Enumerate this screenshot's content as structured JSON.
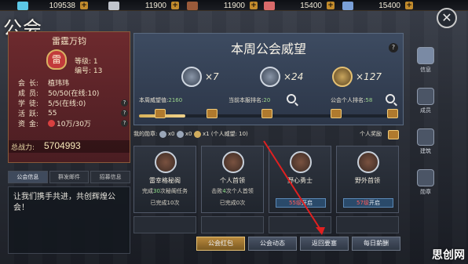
{
  "resources": [
    {
      "value": "109538",
      "color": "#5cc7e6",
      "icon": "diamond-icon"
    },
    {
      "value": "11900",
      "color": "#c0c4cc",
      "icon": "crystal-icon"
    },
    {
      "value": "11900",
      "color": "#9a5a3a",
      "icon": "wood-icon"
    },
    {
      "value": "15400",
      "color": "#d96a6a",
      "icon": "meat-icon"
    },
    {
      "value": "15400",
      "color": "#7aa0d8",
      "icon": "ore-icon"
    }
  ],
  "window": {
    "title": "公会",
    "close": "✕"
  },
  "guild": {
    "name": "雷霆万钧",
    "emblem": "雷",
    "level": "等级: 1",
    "number": "编号: 13",
    "rows": [
      {
        "k": "会",
        "k2": "长:",
        "v": "植玮玮"
      },
      {
        "k": "成",
        "k2": "员:",
        "v": "50/50(在线:10)"
      },
      {
        "k": "学",
        "k2": "徒:",
        "v": "5/5(在线:0)"
      },
      {
        "k": "活",
        "k2": "跃:",
        "v": "55"
      },
      {
        "k": "资",
        "k2": "金:",
        "v": "10万/30万"
      }
    ],
    "power_label": "总战力:",
    "power_value": "5704993"
  },
  "left_tabs": [
    "公会信息",
    "群发邮件",
    "招募信息"
  ],
  "notice": "让我们携手共进，共创辉煌公会！",
  "reputation": {
    "title": "本周公会威望",
    "medals": [
      {
        "mult": "×7"
      },
      {
        "mult": "×24"
      },
      {
        "mult": "×127"
      }
    ],
    "weekly_label": "本周威望值:",
    "weekly_value": "2160",
    "rank_label": "当前本服排名:",
    "rank_value": "20",
    "personal_label": "公会个人排名:",
    "personal_value": "58",
    "progress": 0.18
  },
  "my_medals": {
    "label": "我的勋章:",
    "counts": [
      "x0",
      "x0",
      "x1"
    ],
    "personal": "(个人威望: 10)",
    "reward": "个人奖励"
  },
  "cards": [
    {
      "name": "雷幸格秘阁",
      "desc1": "完成",
      "num": "30",
      "desc2": "次秘阁任务",
      "state": "已完成10次"
    },
    {
      "name": "个人首领",
      "desc1": "击败",
      "num": "4",
      "desc2": "次个人首领",
      "state": "已完成0次"
    },
    {
      "name": "野心勇士",
      "unlock_num": "55级",
      "unlock": "开启"
    },
    {
      "name": "野外首领",
      "unlock_num": "57级",
      "unlock": "开启"
    }
  ],
  "buttons": [
    "公会红包",
    "公会动态",
    "返回要塞",
    "每日薪酬"
  ],
  "nav": [
    "信息",
    "成员",
    "建筑",
    "勋章"
  ],
  "watermark": "思创网"
}
